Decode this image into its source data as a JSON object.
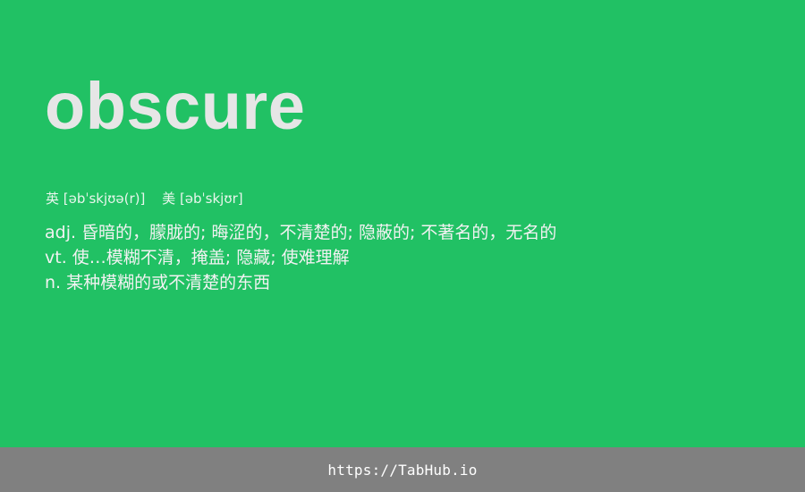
{
  "entry": {
    "word": "obscure",
    "phonetics": {
      "uk": "英 [əbˈskjʊə(r)]",
      "us": "美 [əbˈskjʊr]"
    },
    "definitions": [
      "adj. 昏暗的，朦胧的; 晦涩的，不清楚的; 隐蔽的; 不著名的，无名的",
      "vt. 使…模糊不清，掩盖; 隐藏; 使难理解",
      "n. 某种模糊的或不清楚的东西"
    ]
  },
  "footer": {
    "link_text": "https://TabHub.io"
  },
  "colors": {
    "background": "#21c164",
    "footer_background": "#808080",
    "word_text": "#e6e6e6"
  }
}
